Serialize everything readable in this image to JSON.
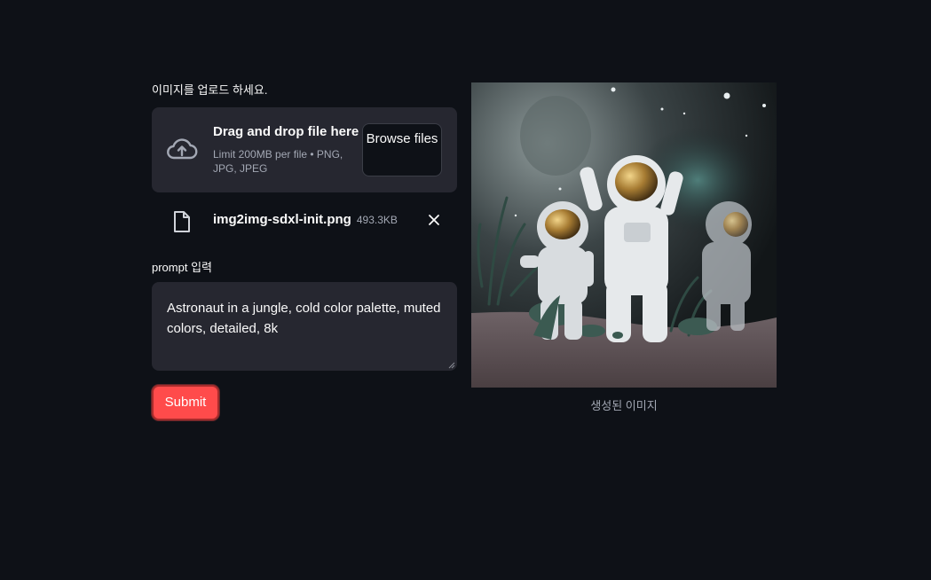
{
  "uploader": {
    "label": "이미지를 업로드 하세요.",
    "dropzone_title": "Drag and drop file here",
    "dropzone_limit": "Limit 200MB per file • PNG, JPG, JPEG",
    "browse_label": "Browse files",
    "icon": "cloud-upload-icon"
  },
  "uploaded_file": {
    "name": "img2img-sdxl-init.png",
    "size": "493.3KB",
    "icon": "file-icon",
    "remove_icon": "close-icon"
  },
  "prompt": {
    "label": "prompt 입력",
    "value": "Astronaut in a jungle, cold color palette, muted colors, detailed, 8k"
  },
  "submit_label": "Submit",
  "output": {
    "caption": "생성된 이미지"
  },
  "colors": {
    "background": "#0e1117",
    "panel": "#262730",
    "accent": "#ff4b4b",
    "muted_text": "#a3a8b4"
  }
}
